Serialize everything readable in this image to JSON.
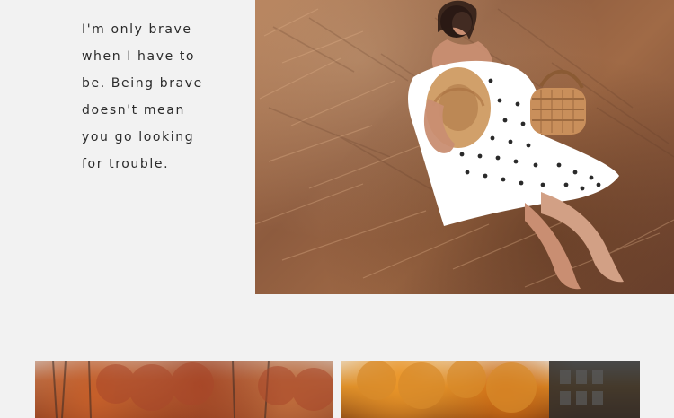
{
  "quote": {
    "lines": [
      "I'm only brave",
      "when I have to",
      "be. Being brave",
      "doesn't mean",
      "you go looking",
      "for trouble."
    ]
  },
  "colors": {
    "background": "#f2f2f2",
    "text": "#2b2b2b",
    "dress": "#ffffff",
    "dots": "#1f1f1f",
    "hat": "#d1a06a",
    "basket": "#c98f5b",
    "hay": "#a46e48",
    "foliage_red": "#a9472a",
    "foliage_orange": "#d88b2b"
  },
  "images": {
    "hero": "woman-in-polka-dot-dress-on-hay",
    "gallery_left": "autumn-trees-red-foliage",
    "gallery_right": "autumn-trees-and-building"
  }
}
